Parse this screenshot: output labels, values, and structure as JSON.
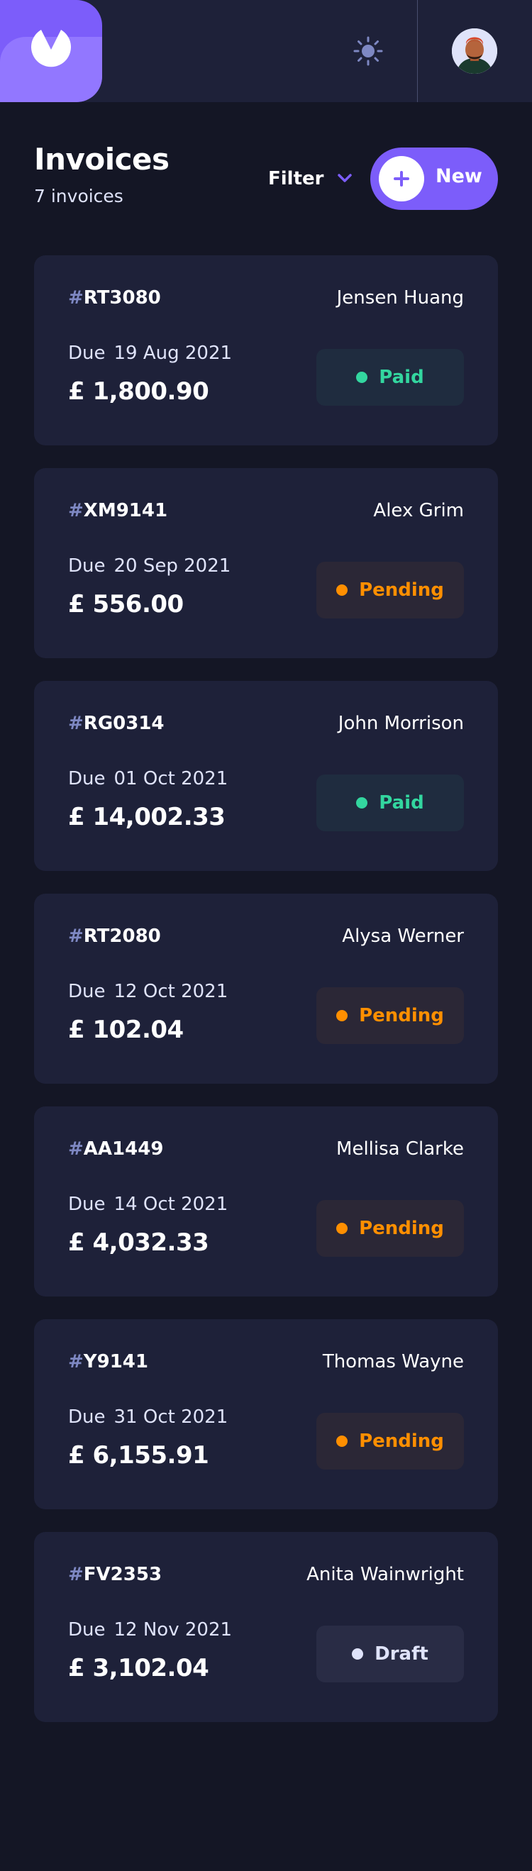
{
  "header": {
    "logo_icon": "brand-logo-icon",
    "theme_toggle_icon": "sun-icon",
    "avatar_icon": "user-avatar"
  },
  "main": {
    "title": "Invoices",
    "count_text": "7 invoices",
    "filter_label": "Filter",
    "new_button_label": "New"
  },
  "colors": {
    "background": "#141625",
    "surface": "#1E2139",
    "accent": "#7C5DFA",
    "paid": "#33D69F",
    "pending": "#FF8F00",
    "draft": "#DFE3FA"
  },
  "invoices": [
    {
      "id": "RT3080",
      "client": "Jensen Huang",
      "due": "19 Aug 2021",
      "amount": "£ 1,800.90",
      "status": "Paid"
    },
    {
      "id": "XM9141",
      "client": "Alex Grim",
      "due": "20 Sep 2021",
      "amount": "£ 556.00",
      "status": "Pending"
    },
    {
      "id": "RG0314",
      "client": "John Morrison",
      "due": "01 Oct 2021",
      "amount": "£ 14,002.33",
      "status": "Paid"
    },
    {
      "id": "RT2080",
      "client": "Alysa Werner",
      "due": "12 Oct 2021",
      "amount": "£ 102.04",
      "status": "Pending"
    },
    {
      "id": "AA1449",
      "client": "Mellisa Clarke",
      "due": "14 Oct 2021",
      "amount": "£ 4,032.33",
      "status": "Pending"
    },
    {
      "id": "Y9141",
      "client": "Thomas Wayne",
      "due": "31 Oct 2021",
      "amount": "£ 6,155.91",
      "status": "Pending"
    },
    {
      "id": "FV2353",
      "client": "Anita Wainwright",
      "due": "12 Nov 2021",
      "amount": "£ 3,102.04",
      "status": "Draft"
    }
  ],
  "labels": {
    "id_prefix": "#",
    "due_prefix": "Due"
  }
}
